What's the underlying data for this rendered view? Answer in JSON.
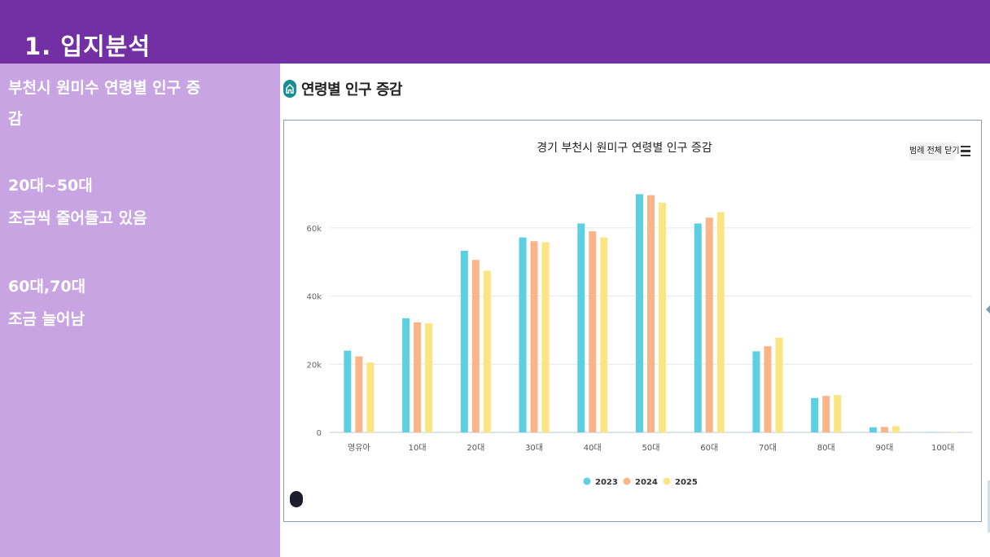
{
  "slide": {
    "title": "1. 입지분석"
  },
  "sidebar": {
    "lines": [
      "부천시 원미수 연령별 인구 증",
      "감",
      "",
      "20대~50대",
      "조금씩 줄어들고 있음",
      "",
      "60대,70대",
      "조금 늘어남"
    ]
  },
  "section": {
    "title": "연령별 인구 증감",
    "icon": "home-icon"
  },
  "controls": {
    "legend_toggle": "범례 전체 닫기",
    "menu_icon": "hamburger-menu-icon"
  },
  "colors": {
    "header": "#7330a4",
    "sidebar": "#c9a4e3",
    "series_2023": "#5ccfe0",
    "series_2024": "#f9b488",
    "series_2025": "#fbe482"
  },
  "chart_data": {
    "type": "bar",
    "title": "경기 부천시 원미구 연령별 인구 증감",
    "xlabel": "",
    "ylabel": "",
    "categories": [
      "영유아",
      "10대",
      "20대",
      "30대",
      "40대",
      "50대",
      "60대",
      "70대",
      "80대",
      "90대",
      "100대"
    ],
    "yticks": [
      {
        "value": 0,
        "label": "0"
      },
      {
        "value": 20000,
        "label": "20k"
      },
      {
        "value": 40000,
        "label": "40k"
      },
      {
        "value": 60000,
        "label": "60k"
      }
    ],
    "ylim": [
      0,
      70000
    ],
    "grid": true,
    "legend_position": "bottom",
    "series": [
      {
        "name": "2023",
        "color": "#5ccfe0",
        "values": [
          24000,
          33500,
          53300,
          57200,
          61300,
          69900,
          61300,
          23800,
          10100,
          1500,
          100
        ]
      },
      {
        "name": "2024",
        "color": "#f9b488",
        "values": [
          22300,
          32300,
          50600,
          56100,
          59000,
          69600,
          63000,
          25300,
          10700,
          1600,
          100
        ]
      },
      {
        "name": "2025",
        "color": "#fbe482",
        "values": [
          20500,
          32000,
          47400,
          55800,
          57200,
          67400,
          64600,
          27800,
          11000,
          1800,
          100
        ]
      }
    ]
  }
}
